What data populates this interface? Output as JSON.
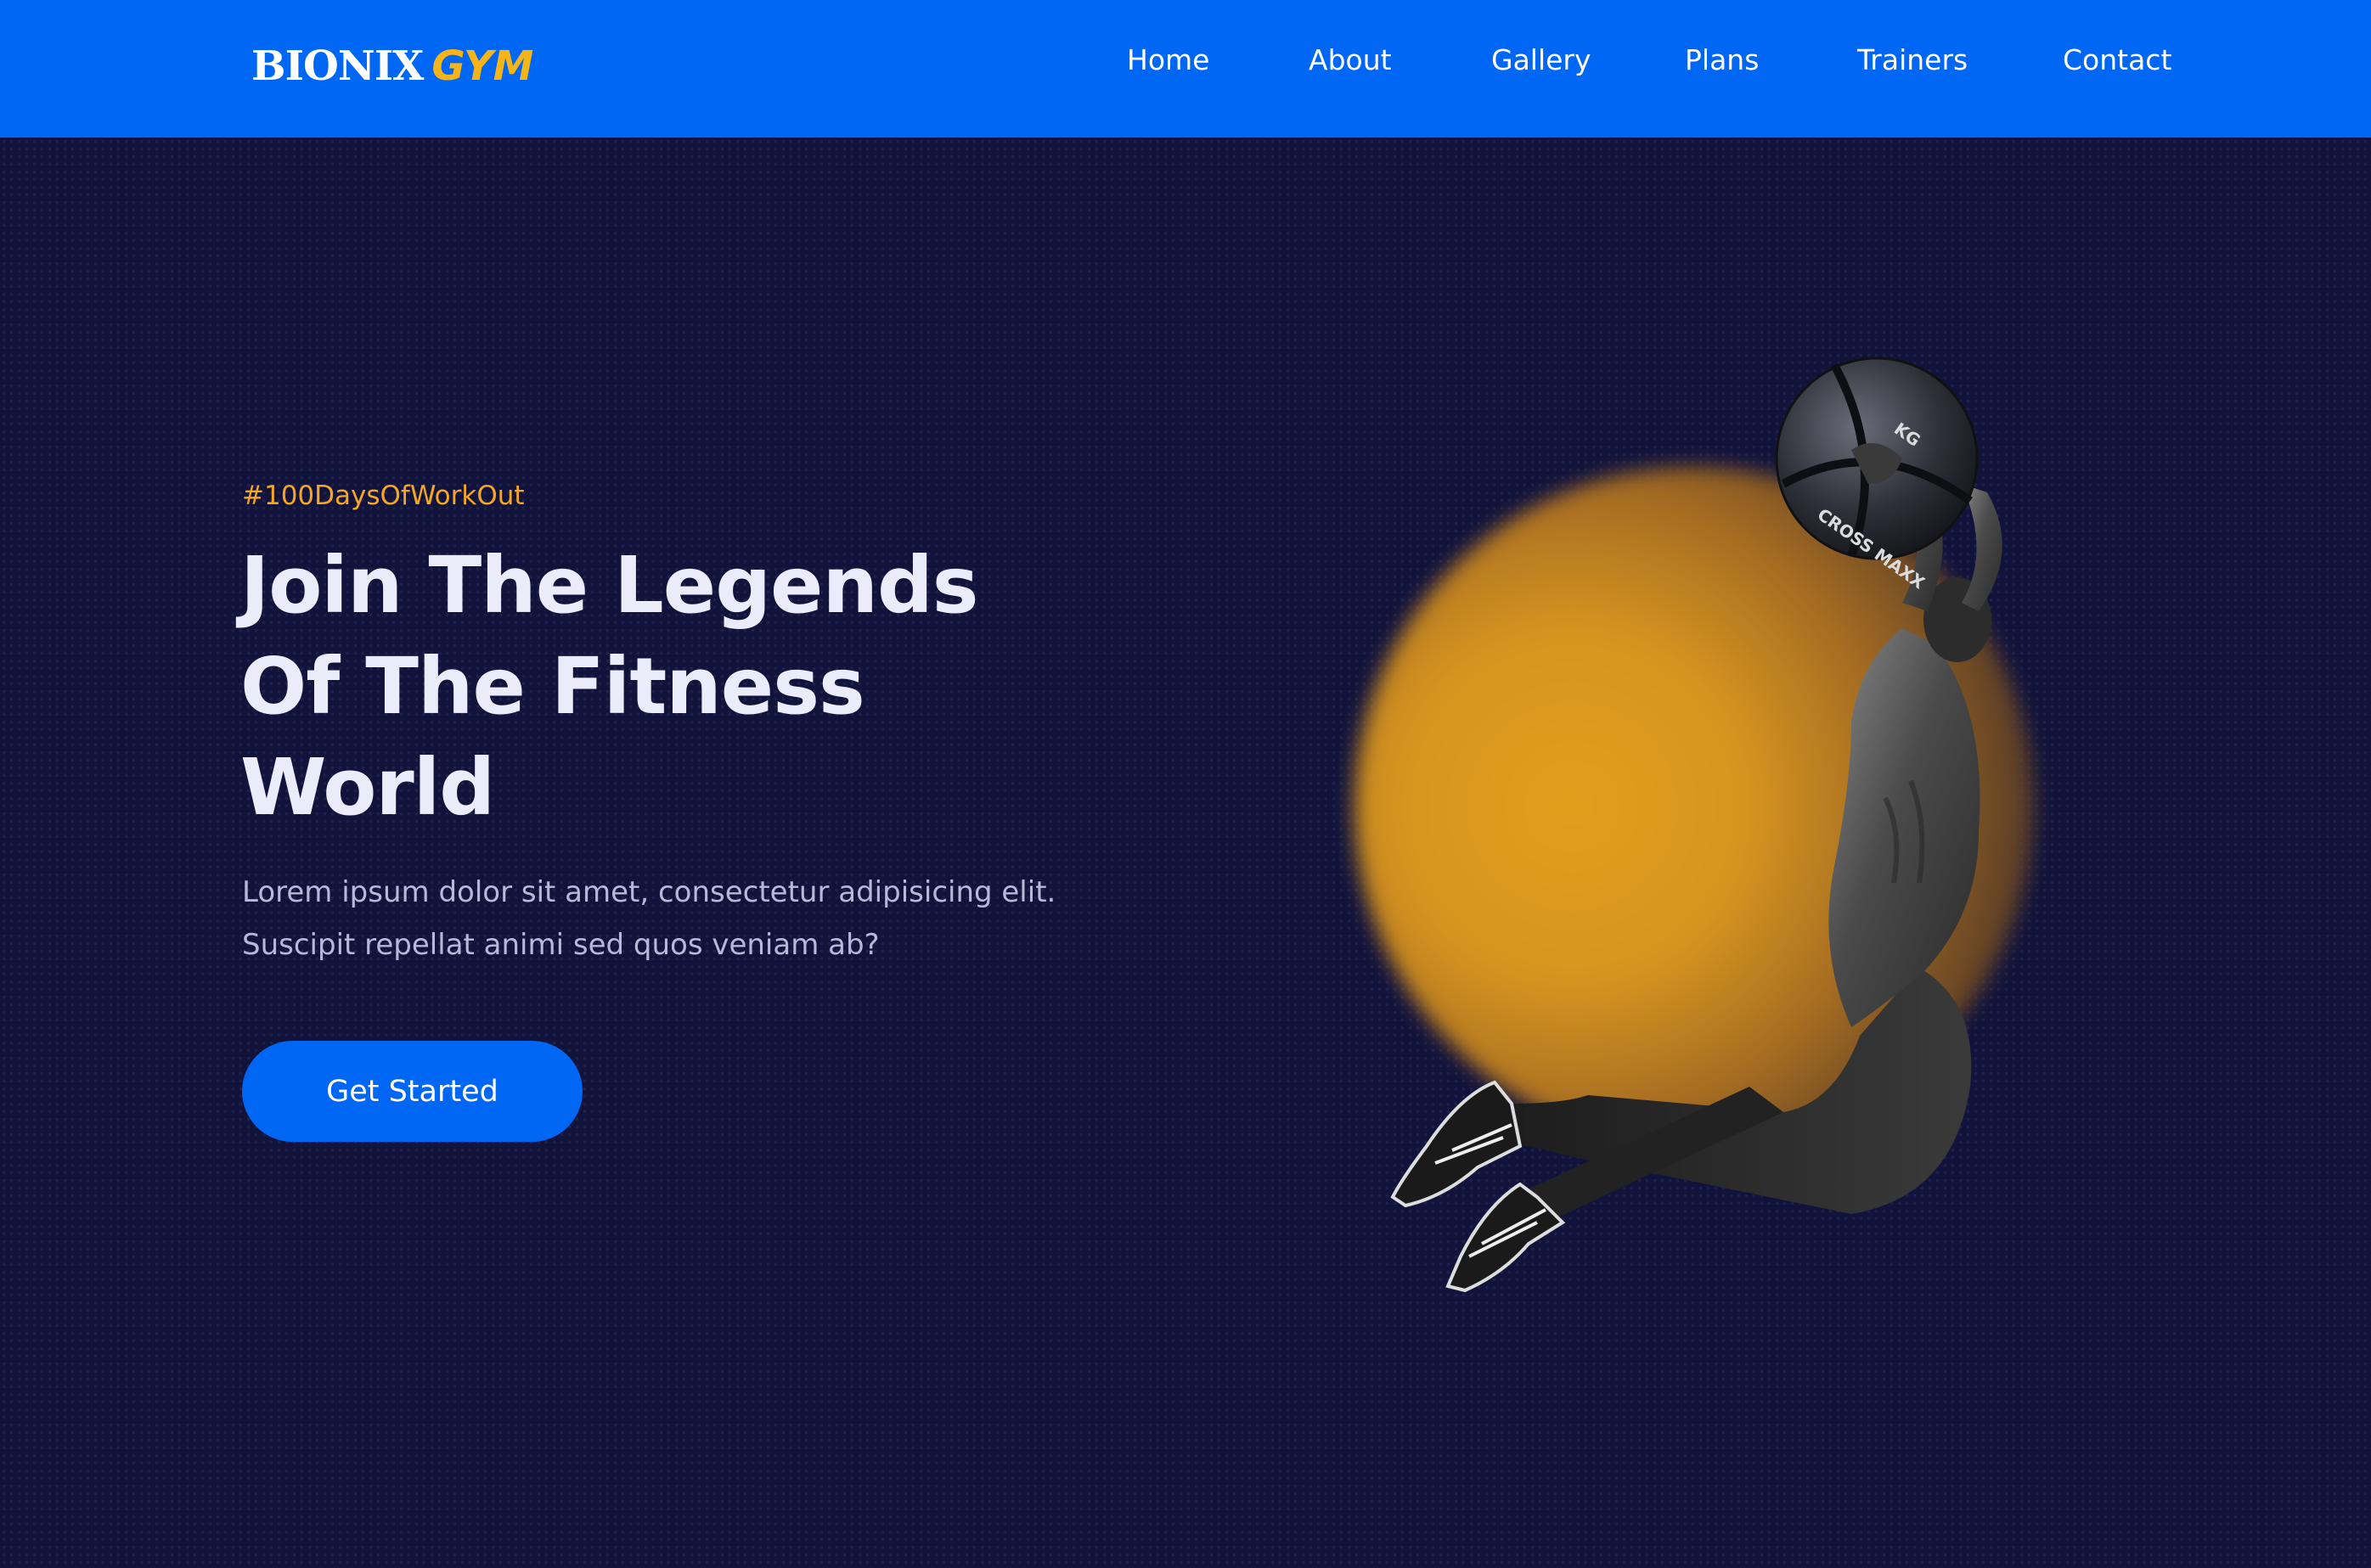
{
  "nav": {
    "logo_main": "BIONIX",
    "logo_accent": "GYM",
    "links": [
      "Home",
      "About",
      "Gallery",
      "Plans",
      "Trainers",
      "Contact"
    ]
  },
  "hero": {
    "hashtag": "#100DaysOfWorkOut",
    "headline_lines": [
      "Join The Legends",
      "Of The Fitness",
      "World"
    ],
    "subtext_lines": [
      "Lorem ipsum dolor sit amet, consectetur adipisicing elit.",
      "Suscipit repellat animi sed quos veniam ab?"
    ],
    "cta_label": "Get Started",
    "ball_text": [
      "CROSS MAXX",
      "KG"
    ]
  },
  "colors": {
    "nav_bg": "#0067f5",
    "page_bg": "#12133a",
    "accent": "#f5a623",
    "cta_bg": "#0067f5",
    "headline": "#ecebfa"
  }
}
